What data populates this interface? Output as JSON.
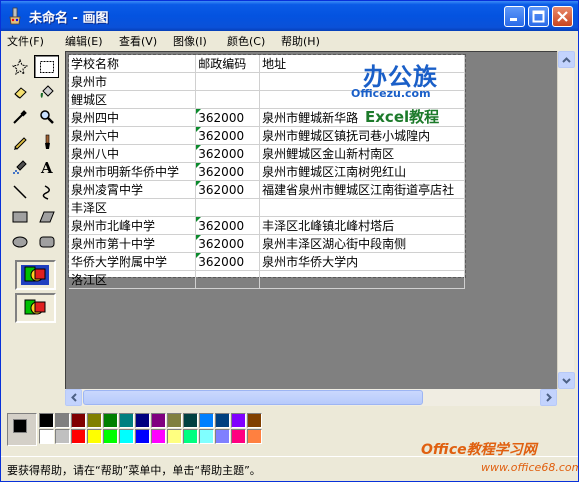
{
  "window": {
    "title": "未命名 - 画图"
  },
  "menu": [
    {
      "label": "文件(F)"
    },
    {
      "label": "编辑(E)"
    },
    {
      "label": "查看(V)"
    },
    {
      "label": "图像(I)"
    },
    {
      "label": "颜色(C)"
    },
    {
      "label": "帮助(H)"
    }
  ],
  "tools": [
    {
      "icon": "free-form-select-icon"
    },
    {
      "icon": "select-icon",
      "selected": true
    },
    {
      "icon": "eraser-icon"
    },
    {
      "icon": "fill-icon"
    },
    {
      "icon": "pick-color-icon"
    },
    {
      "icon": "magnifier-icon"
    },
    {
      "icon": "pencil-icon"
    },
    {
      "icon": "brush-icon"
    },
    {
      "icon": "airbrush-icon"
    },
    {
      "icon": "text-icon"
    },
    {
      "icon": "line-icon"
    },
    {
      "icon": "curve-icon"
    },
    {
      "icon": "rectangle-icon"
    },
    {
      "icon": "polygon-icon"
    },
    {
      "icon": "ellipse-icon"
    },
    {
      "icon": "rounded-rectangle-icon"
    }
  ],
  "sheet": {
    "rows": [
      {
        "name": "学校名称",
        "zip": "邮政编码",
        "addr": "地址",
        "tri": false
      },
      {
        "name": "泉州市",
        "zip": "",
        "addr": "",
        "tri": false
      },
      {
        "name": "鲤城区",
        "zip": "",
        "addr": "",
        "tri": false
      },
      {
        "name": "泉州四中",
        "zip": "362000",
        "addr": "泉州市鲤城新华路",
        "tri": true
      },
      {
        "name": "泉州六中",
        "zip": "362000",
        "addr": "泉州市鲤城区镇抚司巷小城隍内",
        "tri": true
      },
      {
        "name": "泉州八中",
        "zip": "362000",
        "addr": "泉州鲤城区金山新村南区",
        "tri": true
      },
      {
        "name": "泉州市明新华侨中学",
        "zip": "362000",
        "addr": "泉州市鲤城区江南树兜红山",
        "tri": true
      },
      {
        "name": "泉州凌霄中学",
        "zip": "362000",
        "addr": "福建省泉州市鲤城区江南街道亭店社",
        "tri": true
      },
      {
        "name": "丰泽区",
        "zip": "",
        "addr": "",
        "tri": false
      },
      {
        "name": "泉州市北峰中学",
        "zip": "362000",
        "addr": "丰泽区北峰镇北峰村塔后",
        "tri": true
      },
      {
        "name": "泉州市第十中学",
        "zip": "362000",
        "addr": "泉州丰泽区湖心街中段南侧",
        "tri": true
      },
      {
        "name": "华侨大学附属中学",
        "zip": "362000",
        "addr": "泉州市华侨大学内",
        "tri": true
      },
      {
        "name": "洛江区",
        "zip": "",
        "addr": "",
        "tri": false
      }
    ]
  },
  "logo": {
    "main": "办公族",
    "site": "Officezu.com",
    "excel": "Excel教程"
  },
  "palette": {
    "top": [
      "#000000",
      "#808080",
      "#800000",
      "#808000",
      "#008000",
      "#008080",
      "#000080",
      "#800080",
      "#808040",
      "#004040",
      "#0080ff",
      "#004080",
      "#8000ff",
      "#804000"
    ],
    "bottom": [
      "#ffffff",
      "#c0c0c0",
      "#ff0000",
      "#ffff00",
      "#00ff00",
      "#00ffff",
      "#0000ff",
      "#ff00ff",
      "#ffff80",
      "#00ff80",
      "#80ffff",
      "#8080ff",
      "#ff0080",
      "#ff8040"
    ]
  },
  "status": {
    "text": "要获得帮助，请在“帮助”菜单中，单击“帮助主题”。"
  },
  "watermark": {
    "line1": "Office教程学习网",
    "line2": "www.office68.com"
  }
}
